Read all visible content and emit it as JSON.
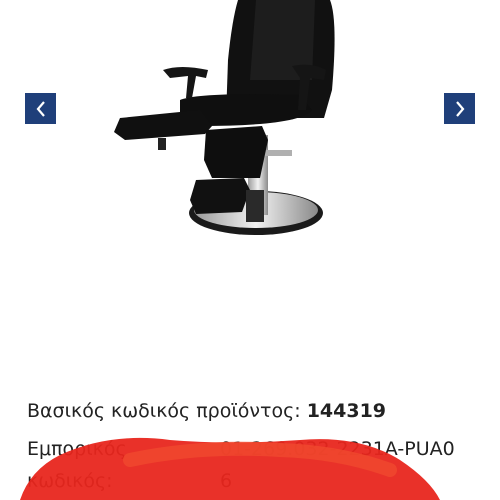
{
  "gallery": {
    "prev_icon": "chevron-left-icon",
    "next_icon": "chevron-right-icon",
    "nav_color": "#1f3f7a",
    "image_alt": "black podiatry chair"
  },
  "product_info": {
    "base_code_label": "Βασικός κωδικός προϊόντος:",
    "base_code_value": "144319",
    "commercial_code_label": "Εμπορικός κωδικός:",
    "commercial_code_value": "01-269.032-2231A-PUA06"
  },
  "annotation": {
    "scribble_color": "#e8261d"
  }
}
